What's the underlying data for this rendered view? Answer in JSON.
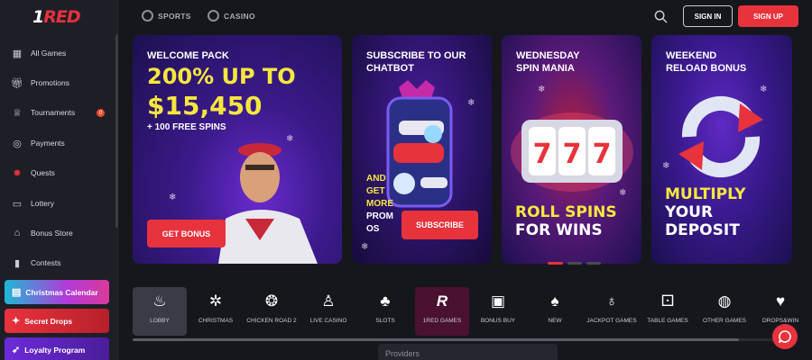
{
  "brand": {
    "logo_one": "1",
    "logo_red": "RED",
    "accent": "#e8323c"
  },
  "header": {
    "tabs": [
      {
        "label": "SPORTS",
        "icon": "soccer-ball-icon"
      },
      {
        "label": "CASINO",
        "icon": "casino-chip-icon"
      }
    ],
    "signin": "SIGN IN",
    "signup": "SIGN UP"
  },
  "sidebar": {
    "items": [
      {
        "label": "All Games",
        "icon": "grid-icon"
      },
      {
        "label": "Promotions",
        "icon": "gift-icon"
      },
      {
        "label": "Tournaments",
        "icon": "trophy-icon",
        "badge": "0"
      },
      {
        "label": "Payments",
        "icon": "coins-icon"
      },
      {
        "label": "Quests",
        "icon": "quest-icon"
      },
      {
        "label": "Lottery",
        "icon": "ticket-icon"
      },
      {
        "label": "Bonus Store",
        "icon": "store-icon"
      },
      {
        "label": "Contests",
        "icon": "bookmark-icon"
      }
    ],
    "promos": [
      {
        "label": "Christmas Calendar",
        "icon": "calendar-icon"
      },
      {
        "label": "Secret Drops",
        "icon": "drops-icon"
      },
      {
        "label": "Loyalty Program",
        "icon": "rocket-icon"
      }
    ]
  },
  "banners": [
    {
      "title_1": "WELCOME PACK",
      "big_1": "200% UP TO",
      "big_2": "$15,450",
      "sub": "+ 100 FREE SPINS",
      "button": "GET BONUS"
    },
    {
      "title_1": "SUBSCRIBE TO OUR",
      "title_2": "CHATBOT",
      "side_1": "AND",
      "side_2": "GET",
      "side_3": "MORE",
      "side_4": "PROM",
      "side_5": "OS",
      "button": "SUBSCRIBE"
    },
    {
      "title_1": "WEDNESDAY",
      "title_2": "SPIN MANIA",
      "big_1": "ROLL SPINS",
      "big_2": "FOR WINS"
    },
    {
      "title_1": "WEEKEND",
      "title_2": "RELOAD BONUS",
      "big_1": "MULTIPLY",
      "big_2": "YOUR",
      "big_3": "DEPOSIT"
    }
  ],
  "categories": [
    {
      "label": "LOBBY",
      "icon": "flame-icon"
    },
    {
      "label": "CHRISTMAS",
      "icon": "ornament-icon"
    },
    {
      "label": "CHICKEN ROAD 2",
      "icon": "chicken-icon"
    },
    {
      "label": "LIVE CASINO",
      "icon": "dealer-icon"
    },
    {
      "label": "SLOTS",
      "icon": "cherry-icon"
    },
    {
      "label": "1RED GAMES",
      "icon": "red-logo-icon"
    },
    {
      "label": "BONUS BUY",
      "icon": "gift-icon"
    },
    {
      "label": "NEW",
      "icon": "cards-icon"
    },
    {
      "label": "JACKPOT GAMES",
      "icon": "money-bag-icon"
    },
    {
      "label": "TABLE GAMES",
      "icon": "table-game-icon"
    },
    {
      "label": "OTHER GAMES",
      "icon": "globe-icon"
    },
    {
      "label": "DROPS&WIN",
      "icon": "cards-icon"
    }
  ],
  "providers": {
    "placeholder": "Providers"
  }
}
